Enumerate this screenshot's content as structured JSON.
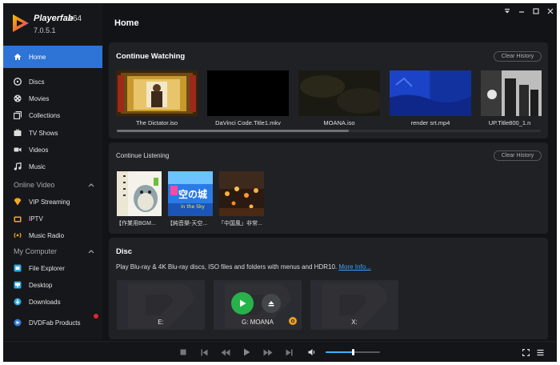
{
  "app": {
    "name": "Playerfab",
    "arch": "x64",
    "version": "7.0.5.1"
  },
  "header": {
    "title": "Home"
  },
  "window_controls": [
    "menu-icon",
    "minimize-icon",
    "maximize-icon",
    "close-icon"
  ],
  "sidebar": {
    "home": "Home",
    "items": [
      {
        "label": "Discs",
        "icon": "disc-icon"
      },
      {
        "label": "Movies",
        "icon": "film-reel-icon"
      },
      {
        "label": "Collections",
        "icon": "collections-icon"
      },
      {
        "label": "TV Shows",
        "icon": "tv-icon"
      },
      {
        "label": "Videos",
        "icon": "video-icon"
      },
      {
        "label": "Music",
        "icon": "music-icon"
      }
    ],
    "online_section": "Online Video",
    "online_items": [
      {
        "label": "VIP Streaming",
        "icon": "vip-icon"
      },
      {
        "label": "IPTV",
        "icon": "iptv-icon"
      },
      {
        "label": "Music Radio",
        "icon": "radio-icon"
      }
    ],
    "computer_section": "My Computer",
    "computer_items": [
      {
        "label": "File Explorer",
        "icon": "file-explorer-icon"
      },
      {
        "label": "Desktop",
        "icon": "desktop-icon"
      },
      {
        "label": "Downloads",
        "icon": "downloads-icon"
      }
    ],
    "products": "DVDFab Products"
  },
  "continue_watching": {
    "title": "Continue Watching",
    "clear_label": "Clear History",
    "items": [
      "The Dictator.iso",
      "DaVinci Code.Title1.mkv",
      "MOANA.iso",
      "render srt.mp4",
      "UP.Title800_1.n"
    ]
  },
  "continue_listening": {
    "title": "Continue Listening",
    "clear_label": "Clear History",
    "items": [
      "【作業用BGM...",
      "【純音樂-天空...",
      "「中国風」非常..."
    ],
    "covers": {
      "center_text": "空の城",
      "strip_text": "in the Sky"
    }
  },
  "disc": {
    "title": "Disc",
    "description": "Play Blu-ray & 4K Blu-ray discs, ISO files and folders with menus and HDR10.",
    "more_info": "More Info...",
    "drives": [
      "E:",
      "G: MOANA",
      "X:"
    ]
  },
  "player": {
    "volume": 0.5
  },
  "colors": {
    "accent": "#2d74d6",
    "play_green": "#27b24a",
    "link": "#3aa2ff",
    "notification": "#e3262b"
  }
}
